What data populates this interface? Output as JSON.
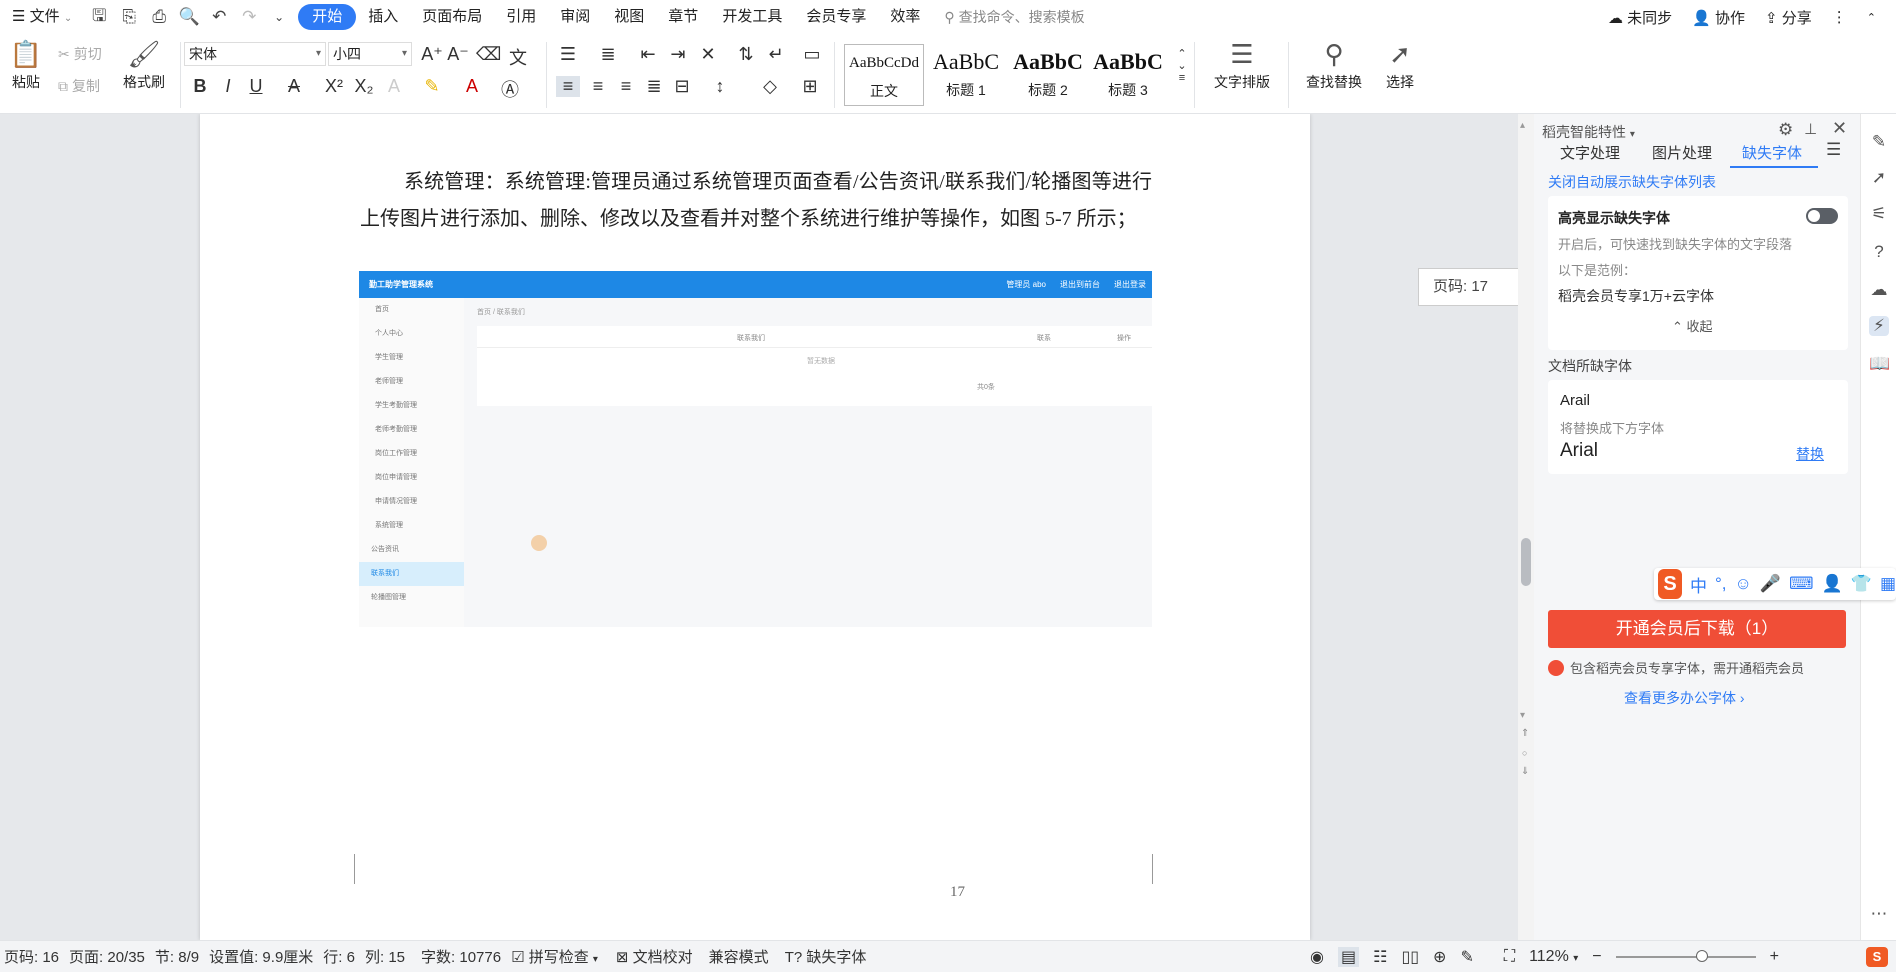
{
  "menubar": {
    "file_label": "文件",
    "tabs": [
      "开始",
      "插入",
      "页面布局",
      "引用",
      "审阅",
      "视图",
      "章节",
      "开发工具",
      "会员专享",
      "效率"
    ],
    "active_tab": "开始",
    "search_placeholder": "查找命令、搜索模板",
    "sync_label": "未同步",
    "collab_label": "协作",
    "share_label": "分享"
  },
  "ribbon": {
    "paste": "粘贴",
    "cut": "剪切",
    "copy": "复制",
    "format_painter": "格式刷",
    "font_name": "宋体",
    "font_size": "小四",
    "styles": [
      {
        "sample": "AaBbCcDd",
        "label": "正文"
      },
      {
        "sample": "AaBbC",
        "label": "标题 1"
      },
      {
        "sample": "AaBbC",
        "label": "标题 2"
      },
      {
        "sample": "AaBbC",
        "label": "标题 3"
      }
    ],
    "text_layout": "文字排版",
    "find_replace": "查找替换",
    "select": "选择"
  },
  "document": {
    "paragraph": "系统管理：系统管理:管理员通过系统管理页面查看/公告资讯/联系我们/轮播图等进行上传图片进行添加、删除、修改以及查看并对整个系统进行维护等操作，如图 5-7 所示；",
    "embedded_screenshot": {
      "title": "勤工助学管理系统",
      "header_right": [
        "管理员 abo",
        "退出到前台",
        "退出登录"
      ],
      "breadcrumb": "首页 / 联系我们",
      "sidebar": [
        "首页",
        "个人中心",
        "学生管理",
        "老师管理",
        "学生考勤管理",
        "老师考勤管理",
        "岗位工作管理",
        "岗位申请管理",
        "申请情况管理",
        "系统管理",
        "公告资讯",
        "联系我们",
        "轮播图管理"
      ],
      "selected_item": "联系我们",
      "table_headers": [
        "联系我们",
        "联系",
        "操作"
      ],
      "empty_text": "暂无数据",
      "pager": "共0条"
    },
    "page_number": "17",
    "page_tooltip": "页码: 17"
  },
  "panel": {
    "title": "稻壳智能特性",
    "tabs": [
      "文字处理",
      "图片处理",
      "缺失字体"
    ],
    "active_tab": "缺失字体",
    "close_auto_link": "关闭自动展示缺失字体列表",
    "highlight_title": "高亮显示缺失字体",
    "highlight_desc": "开启后，可快速找到缺失字体的文字段落",
    "example_label": "以下是范例：",
    "example_font": "稻壳会员专享1万+云字体",
    "collapse": "收起",
    "missing_section": "文档所缺字体",
    "missing_font": "Arail",
    "replace_with_label": "将替换成下方字体",
    "replacement_font": "Arial",
    "replace_link": "替换",
    "download_button": "开通会员后下载（1）",
    "vip_note": "包含稻壳会员专享字体，需开通稻壳会员",
    "more_fonts": "查看更多办公字体"
  },
  "statusbar": {
    "page": "页码: 16",
    "pages": "页面: 20/35",
    "section": "节: 8/9",
    "setting": "设置值: 9.9厘米",
    "row": "行: 6",
    "col": "列: 15",
    "words": "字数: 10776",
    "spell": "拼写检查",
    "proof": "文档校对",
    "compat": "兼容模式",
    "missing_font": "缺失字体",
    "zoom": "112%"
  },
  "ime": {
    "mode": "中"
  }
}
